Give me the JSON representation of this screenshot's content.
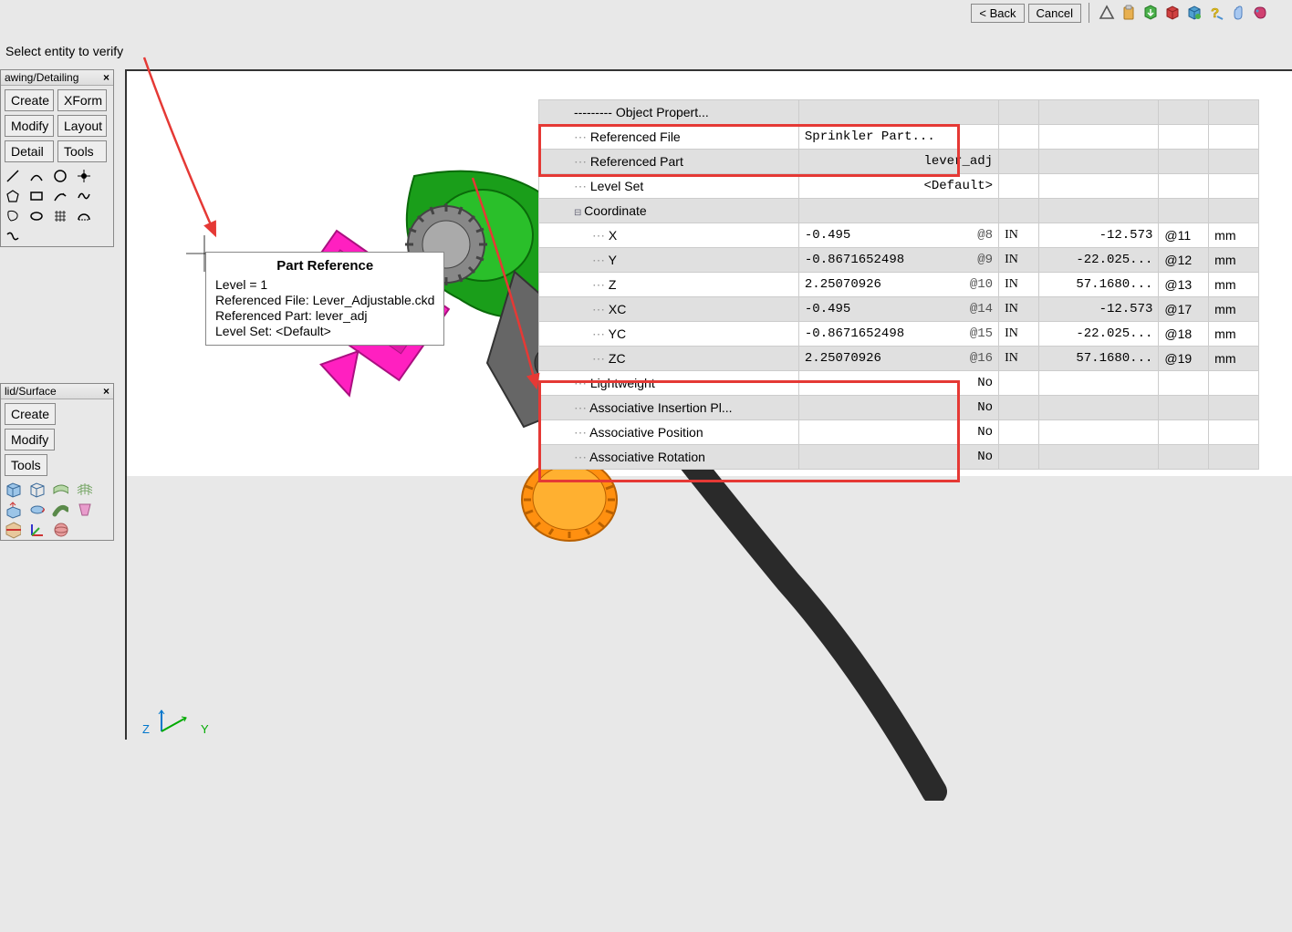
{
  "header": {
    "back": "< Back",
    "cancel": "Cancel"
  },
  "prompt": "Select entity to verify",
  "panels": {
    "drawing": {
      "title": "awing/Detailing",
      "buttons": [
        "Create",
        "XForm",
        "Modify",
        "Layout",
        "Detail",
        "Tools"
      ]
    },
    "solid": {
      "title": "lid/Surface",
      "buttons": [
        "Create",
        "Modify",
        "Tools"
      ]
    }
  },
  "tooltip": {
    "title": "Part Reference",
    "level": "Level = 1",
    "file": "Referenced File: Lever_Adjustable.ckd",
    "part": "Referenced Part: lever_adj",
    "levelset": "Level Set: <Default>"
  },
  "table": {
    "rows": [
      {
        "name": "--------- Object Propert...",
        "val": "",
        "u1": "",
        "u2": "",
        "u3": "",
        "u4": "",
        "red": false,
        "indent": false,
        "lead": false
      },
      {
        "name": "Referenced File",
        "val": "Sprinkler Part...",
        "u1": "",
        "u2": "",
        "u3": "",
        "u4": "",
        "red": true,
        "indent": false,
        "lead": true,
        "valleft": true
      },
      {
        "name": "Referenced Part",
        "val": "lever_adj",
        "u1": "",
        "u2": "",
        "u3": "",
        "u4": "",
        "red": true,
        "indent": false,
        "lead": true
      },
      {
        "name": "Level Set",
        "val": "<Default>",
        "u1": "",
        "u2": "",
        "u3": "",
        "u4": "",
        "red": false,
        "indent": false,
        "lead": true
      },
      {
        "name": "Coordinate",
        "val": "",
        "u1": "",
        "u2": "",
        "u3": "",
        "u4": "",
        "red": false,
        "indent": false,
        "lead": false,
        "expand": true
      },
      {
        "name": "X",
        "val": "-0.495",
        "id": "@8",
        "u1": "IN",
        "u2": "-12.573",
        "u3": "@11",
        "u4": "mm",
        "red": false,
        "indent": true,
        "lead": true
      },
      {
        "name": "Y",
        "val": "-0.8671652498",
        "id": "@9",
        "u1": "IN",
        "u2": "-22.025...",
        "u3": "@12",
        "u4": "mm",
        "red": false,
        "indent": true,
        "lead": true
      },
      {
        "name": "Z",
        "val": "2.25070926",
        "id": "@10",
        "u1": "IN",
        "u2": "57.1680...",
        "u3": "@13",
        "u4": "mm",
        "red": false,
        "indent": true,
        "lead": true
      },
      {
        "name": "XC",
        "val": "-0.495",
        "id": "@14",
        "u1": "IN",
        "u2": "-12.573",
        "u3": "@17",
        "u4": "mm",
        "red": false,
        "indent": true,
        "lead": true
      },
      {
        "name": "YC",
        "val": "-0.8671652498",
        "id": "@15",
        "u1": "IN",
        "u2": "-22.025...",
        "u3": "@18",
        "u4": "mm",
        "red": false,
        "indent": true,
        "lead": true
      },
      {
        "name": "ZC",
        "val": "2.25070926",
        "id": "@16",
        "u1": "IN",
        "u2": "57.1680...",
        "u3": "@19",
        "u4": "mm",
        "red": false,
        "indent": true,
        "lead": true
      },
      {
        "name": "Lightweight",
        "val": "No",
        "u1": "",
        "u2": "",
        "u3": "",
        "u4": "",
        "red": true,
        "indent": false,
        "lead": true
      },
      {
        "name": "Associative Insertion Pl...",
        "val": "No",
        "u1": "",
        "u2": "",
        "u3": "",
        "u4": "",
        "red": true,
        "indent": false,
        "lead": true
      },
      {
        "name": "Associative Position",
        "val": "No",
        "u1": "",
        "u2": "",
        "u3": "",
        "u4": "",
        "red": true,
        "indent": false,
        "lead": true
      },
      {
        "name": "Associative Rotation",
        "val": "No",
        "u1": "",
        "u2": "",
        "u3": "",
        "u4": "",
        "red": true,
        "indent": false,
        "lead": true
      }
    ]
  },
  "axes": {
    "z": "Z",
    "y": "Y"
  },
  "icons": {
    "triangle": "△",
    "clipboard": "📋",
    "box": "📦",
    "cube": "🟥",
    "stack": "🧊",
    "help": "❓",
    "hand": "✋",
    "record": "⏺"
  }
}
